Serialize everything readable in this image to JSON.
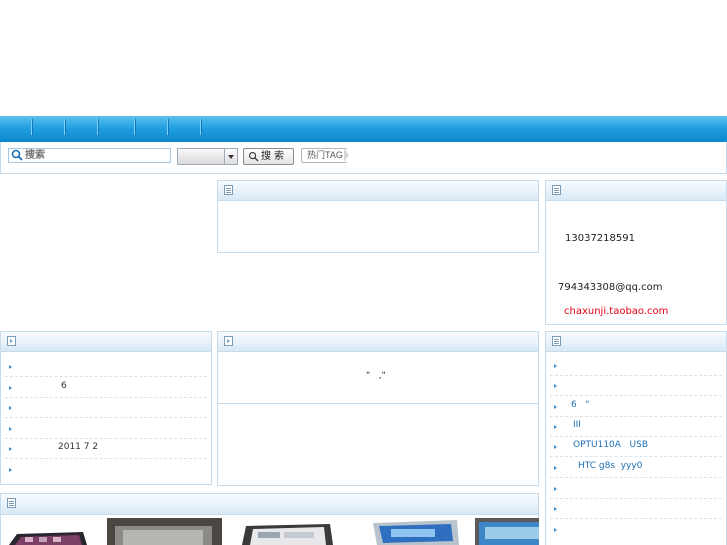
{
  "search": {
    "placeholder": "搜索",
    "button_label": "搜索",
    "hot_tag_label": "热门TAG"
  },
  "contact": {
    "phone": "13037218591",
    "email": "794343308@qq.com",
    "shop": "chaxunji.taobao.com",
    "shop_color": "#e60012"
  },
  "left_list": {
    "items": [
      "",
      "6",
      "",
      "",
      "2011 7 2",
      ""
    ]
  },
  "center_panel": {
    "text": "\"   ,\""
  },
  "right_list": {
    "items": [
      "",
      "",
      "6   \"",
      "III",
      "OPTU110A   USB",
      "HTC g8s  yyy0",
      "",
      "",
      ""
    ]
  },
  "gallery": {
    "thumbs": [
      "product-1",
      "product-2",
      "product-3",
      "product-4",
      "product-5"
    ]
  },
  "colors": {
    "nav_top": "#5fc0ee",
    "nav_bottom": "#0c86cc",
    "panel_border": "#c7dbea"
  }
}
